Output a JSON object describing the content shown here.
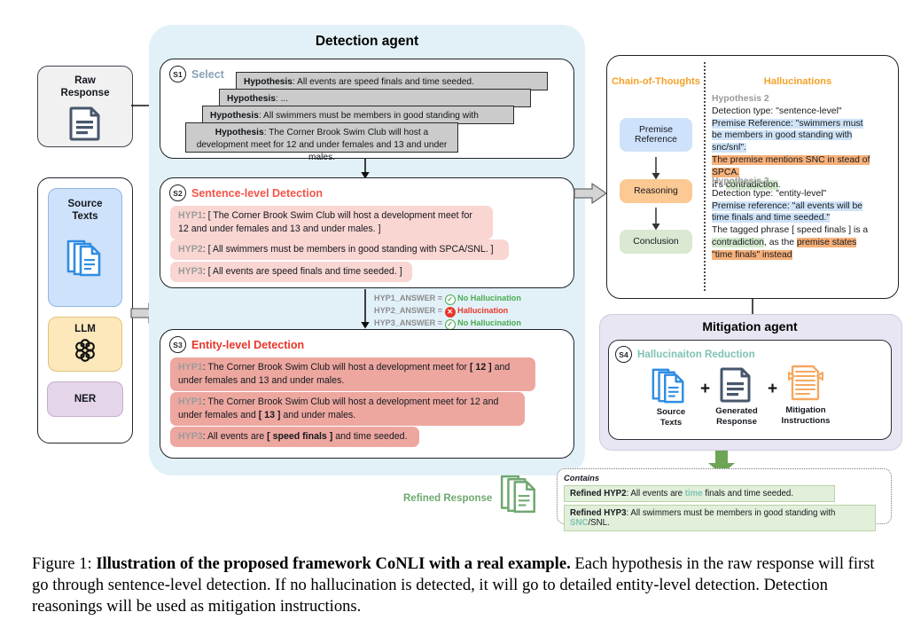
{
  "left_column": {
    "raw_response": {
      "title": "Raw\nResponse",
      "icon": "document-icon"
    },
    "source_texts": {
      "title": "Source\nTexts",
      "icon": "documents-stack-icon"
    },
    "llm": {
      "title": "LLM",
      "icon": "openai-logo-icon"
    },
    "ner": {
      "title": "NER"
    }
  },
  "detection_agent": {
    "title": "Detection agent",
    "s1": {
      "badge": "S1",
      "label": "Select",
      "label_color": "#8aa1b8",
      "hypotheses": [
        {
          "prefix": "Hypothesis",
          "text": ": All events are speed finals and time seeded."
        },
        {
          "prefix": "Hypothesis",
          "text": ": ..."
        },
        {
          "prefix": "Hypothesis",
          "text": ": All swimmers must be members in good standing with SPCA/SNL."
        },
        {
          "prefix": "Hypothesis",
          "text": ": The Corner Brook Swim Club will host a development meet for 12 and under females and 13 and under males."
        }
      ]
    },
    "s2": {
      "badge": "S2",
      "label": "Sentence-level Detection",
      "label_color": "#f4544a",
      "items": [
        {
          "tag": "HYP1",
          "text": ": [ The Corner Brook Swim Club will host a development meet for 12 and under females and 13 and under males. ]"
        },
        {
          "tag": "HYP2",
          "text": ": [ All swimmers must be members in good standing with SPCA/SNL. ]"
        },
        {
          "tag": "HYP3",
          "text": ": [ All events are speed finals and time seeded. ]"
        }
      ]
    },
    "answers": [
      {
        "key": "HYP1_ANSWER =",
        "status": "No Hallucination",
        "ok": true
      },
      {
        "key": "HYP2_ANSWER =",
        "status": "Hallucination",
        "ok": false
      },
      {
        "key": "HYP3_ANSWER =",
        "status": "No Hallucination",
        "ok": true
      }
    ],
    "s3": {
      "badge": "S3",
      "label": "Entity-level Detection",
      "label_color": "#e8362a",
      "items": [
        {
          "tag": "HYP1",
          "pre": ": The Corner Brook Swim Club will host a development meet for ",
          "mark": "[ 12 ]",
          "post": " and under females and 13 and under males."
        },
        {
          "tag": "HYP1",
          "pre": ": The Corner Brook Swim Club will host a development meet for 12 and under females and ",
          "mark": "[ 13 ]",
          "post": " and under males."
        },
        {
          "tag": "HYP3",
          "pre": ": All events are ",
          "mark": "[ speed finals ]",
          "post": " and time seeded."
        }
      ]
    }
  },
  "cot_panel": {
    "left_header": "Chain-of-Thoughts",
    "right_header": "Hallucinations",
    "nodes": [
      {
        "label": "Premise\nReference",
        "color": "#cfe2fb"
      },
      {
        "label": "Reasoning",
        "color": "#fcc893"
      },
      {
        "label": "Conclusion",
        "color": "#d9e9d2"
      }
    ],
    "hallucinations": [
      {
        "heading": "Hypothesis 2",
        "lines": [
          {
            "segments": [
              {
                "t": "Detection type: \"sentence-level\"",
                "hl": "none"
              }
            ]
          },
          {
            "segments": [
              {
                "t": "Premise Reference: \"swimmers must be members in good standing with snc/snl\".",
                "hl": "blue"
              }
            ]
          },
          {
            "segments": [
              {
                "t": "The premise mentions SNC in stead of SPCA.",
                "hl": "orange"
              }
            ]
          },
          {
            "segments": [
              {
                "t": "It's ",
                "hl": "none"
              },
              {
                "t": "contradiction",
                "hl": "green"
              },
              {
                "t": ".",
                "hl": "none"
              }
            ]
          }
        ]
      },
      {
        "heading": "Hypothesis 3",
        "lines": [
          {
            "segments": [
              {
                "t": "Detection type: \"entity-level\"",
                "hl": "none"
              }
            ]
          },
          {
            "segments": [
              {
                "t": "Premise reference: \"all events will be time finals and time seeded.\"",
                "hl": "blue"
              }
            ]
          },
          {
            "segments": [
              {
                "t": "The tagged phrase [ speed finals ] is a ",
                "hl": "none"
              },
              {
                "t": "contradiction",
                "hl": "green"
              },
              {
                "t": ", as the ",
                "hl": "none"
              },
              {
                "t": "premise states \"time finals\" instead",
                "hl": "orange"
              }
            ]
          }
        ]
      }
    ]
  },
  "mitigation_agent": {
    "title": "Mitigation agent",
    "badge": "S4",
    "step_label": "Hallucinaiton Reduction",
    "inputs": [
      {
        "caption": "Source\nTexts",
        "icon": "documents-stack-icon",
        "color": "#2f8de4"
      },
      {
        "caption": "Generated\nResponse",
        "icon": "document-icon",
        "color": "#47566b"
      },
      {
        "caption": "Mitigation\nInstructions",
        "icon": "instructions-icon",
        "color": "#f5a760"
      }
    ],
    "operator": "+"
  },
  "refined": {
    "label": "Refined Response",
    "icon": "documents-stack-icon",
    "contains_title": "Contains",
    "items": [
      {
        "prefix": "Refined HYP2",
        "pre": ": All events are ",
        "hl": "time",
        "post": " finals and time seeded."
      },
      {
        "prefix": "Refined HYP3",
        "pre": ": All swimmers must be members in good standing with ",
        "hl": "SNC",
        "post": "/SNL."
      }
    ]
  },
  "caption": {
    "figure_no": "Figure 1: ",
    "bold": "Illustration of the proposed framework CoNLI with a real example.",
    "rest": " Each hypothesis in the raw response will first go through sentence-level detection. If no hallucination is detected, it will go to detailed entity-level detection. Detection reasonings will be used as mitigation instructions."
  },
  "colors": {
    "detect_bg": "#e2f1f8",
    "mitigate_bg": "#e8e6f2",
    "accent_orange": "#f5a127",
    "accent_red": "#e8362a",
    "accent_green": "#6fa870",
    "accent_teal": "#7fc2b4"
  }
}
